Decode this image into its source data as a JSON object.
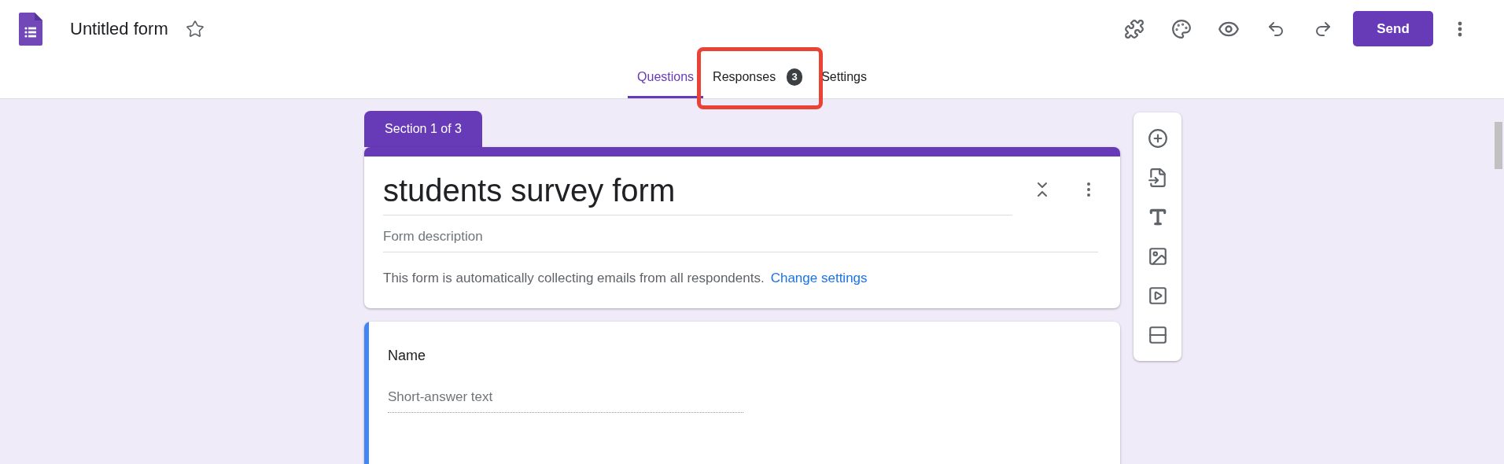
{
  "app": {
    "title": "Untitled form",
    "send_button": "Send"
  },
  "tabs": [
    {
      "label": "Questions",
      "selected": true,
      "highlighted": false
    },
    {
      "label": "Responses",
      "selected": false,
      "badge": "3",
      "highlighted": true
    },
    {
      "label": "Settings",
      "selected": false,
      "highlighted": false
    }
  ],
  "section_tab": "Section 1 of 3",
  "header_card": {
    "title": "students survey form",
    "description_placeholder": "Form description",
    "notice": "This form is automatically collecting emails from all respondents.",
    "notice_link": "Change settings"
  },
  "questions": [
    {
      "title": "Name",
      "answer_placeholder": "Short-answer text"
    }
  ]
}
